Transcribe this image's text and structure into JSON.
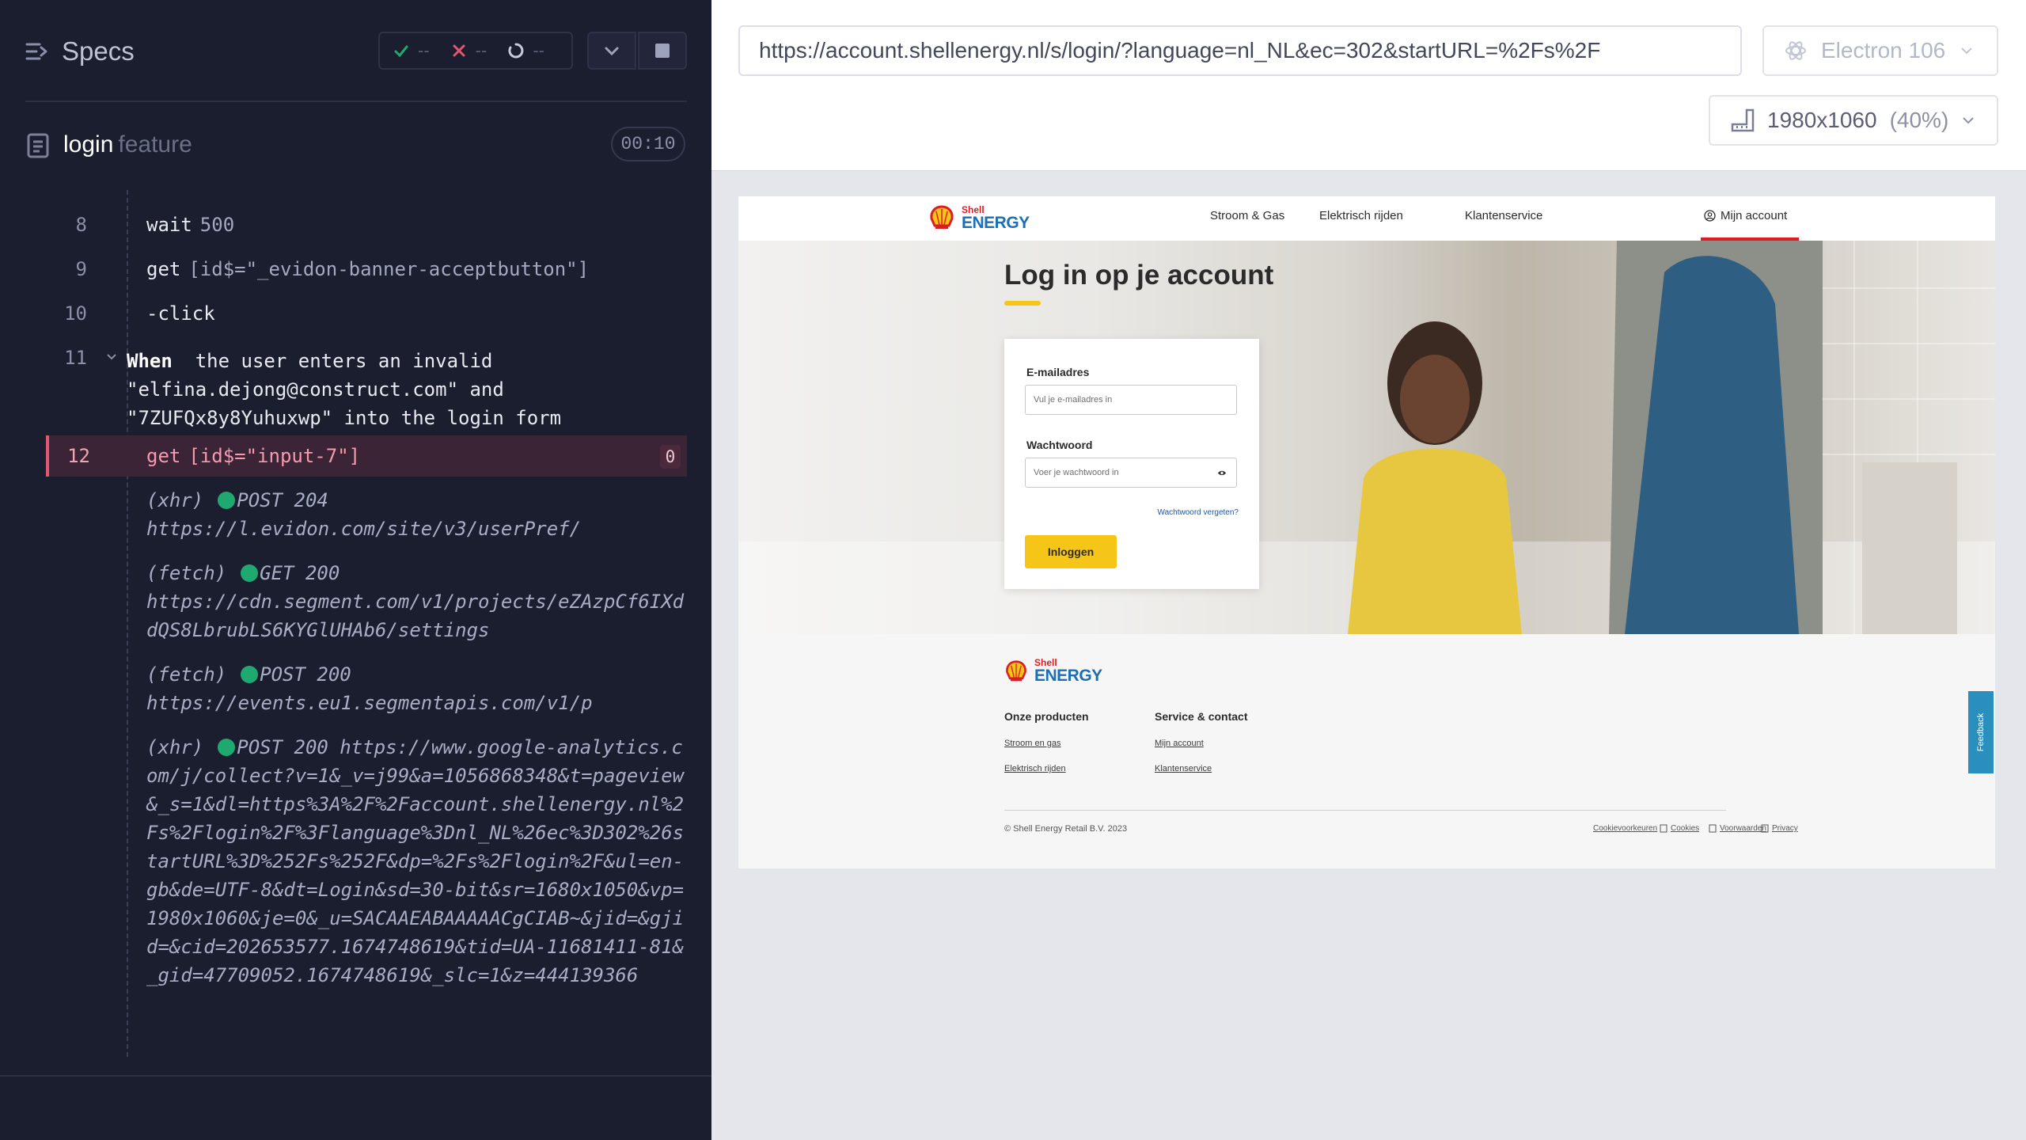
{
  "reporter": {
    "title": "Specs",
    "stats": {
      "passed": "--",
      "failed": "--",
      "pending": "--"
    },
    "spec": {
      "name": "login",
      "kind": "feature",
      "duration": "00:10"
    },
    "commands": [
      {
        "num": "8",
        "name": "wait",
        "arg": "500"
      },
      {
        "num": "9",
        "name": "get",
        "arg": "[id$=\"_evidon-banner-acceptbutton\"]"
      },
      {
        "num": "10",
        "name": "-click",
        "arg": ""
      },
      {
        "num": "11",
        "keyword": "When",
        "line1": "the user enters an invalid",
        "line2": "\"elfina.dejong@construct.com\" and",
        "line3": "\"7ZUFQx8y8Yuhuxwp\" into the login form"
      },
      {
        "num": "12",
        "name": "get",
        "arg": "[id$=\"input-7\"]",
        "badge": "0"
      }
    ],
    "requests": [
      {
        "kind": "(xhr)",
        "method": "POST 204",
        "url": "https://l.evidon.com/site/v3/userPref/"
      },
      {
        "kind": "(fetch)",
        "method": "GET 200",
        "url": "https://cdn.segment.com/v1/projects/eZAzpCf6IXddQS8LbrubLS6KYGlUHAb6/settings"
      },
      {
        "kind": "(fetch)",
        "method": "POST 200",
        "url": "https://events.eu1.segmentapis.com/v1/p"
      },
      {
        "kind": "(xhr)",
        "method": "POST 200",
        "url": "https://www.google-analytics.com/j/collect?v=1&_v=j99&a=1056868348&t=pageview&_s=1&dl=https%3A%2F%2Faccount.shellenergy.nl%2Fs%2Flogin%2F%3Flanguage%3Dnl_NL%26ec%3D302%26startURL%3D%252Fs%252F&dp=%2Fs%2Flogin%2F&ul=en-gb&de=UTF-8&dt=Login&sd=30-bit&sr=1680x1050&vp=1980x1060&je=0&_u=SACAAEABAAAAACgCIAB~&jid=&gjid=&cid=202653577.1674748619&tid=UA-11681411-81&_gid=47709052.1674748619&_slc=1&z=444139366"
      }
    ]
  },
  "aut": {
    "url": "https://account.shellenergy.nl/s/login/?language=nl_NL&ec=302&startURL=%2Fs%2F",
    "browser": "Electron 106",
    "viewport": "1980x1060",
    "zoom": "(40%)"
  },
  "site": {
    "brand_top": "Shell",
    "brand_bottom": "ENERGY",
    "nav": [
      "Stroom & Gas",
      "Elektrisch rijden",
      "Klantenservice"
    ],
    "account": "Mijn account",
    "login_title": "Log in op je account",
    "email_label": "E-mailadres",
    "email_placeholder": "Vul je e-mailadres in",
    "password_label": "Wachtwoord",
    "password_placeholder": "Voer je wachtwoord in",
    "forgot": "Wachtwoord vergeten?",
    "login_button": "Inloggen",
    "footer": {
      "col1_title": "Onze producten",
      "col1_links": [
        "Stroom en gas",
        "Elektrisch rijden"
      ],
      "col2_title": "Service & contact",
      "col2_links": [
        "Mijn account",
        "Klantenservice"
      ],
      "copyright": "© Shell Energy Retail B.V. 2023",
      "legal": [
        "Cookievoorkeuren",
        "Cookies",
        "Voorwaarden",
        "Privacy"
      ]
    },
    "feedback": "Feedback"
  },
  "colors": {
    "reporter_bg": "#1b1e2e",
    "active_command": "#e45770",
    "success_dot": "#1fa971",
    "shell_red": "#dd1d21",
    "shell_yellow": "#f5c518",
    "energy_blue": "#1a6fb5"
  }
}
